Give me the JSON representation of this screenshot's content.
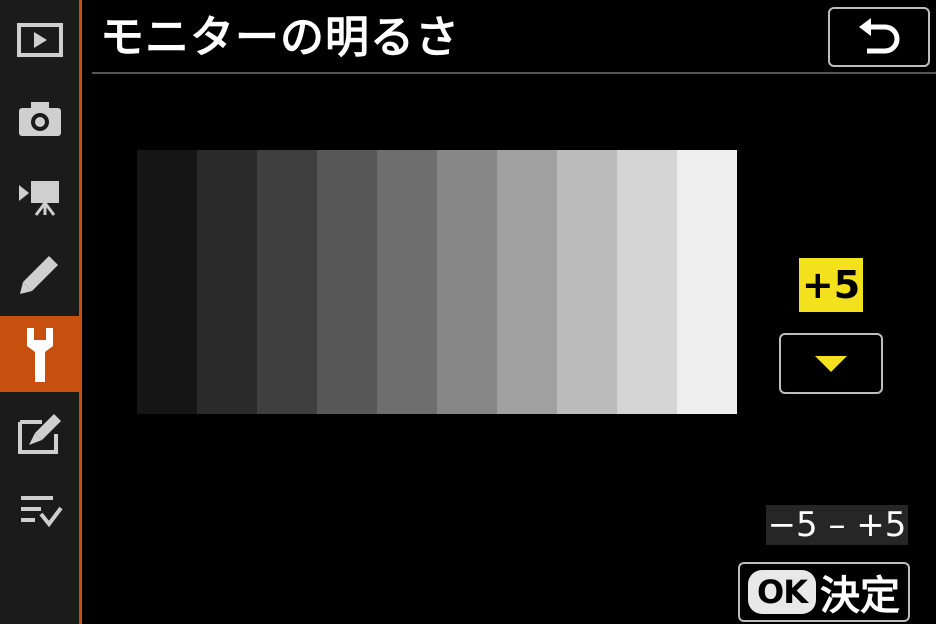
{
  "title": "モニターの明るさ",
  "sidebar": {
    "items": [
      {
        "icon": "playback-icon",
        "active": false
      },
      {
        "icon": "camera-icon",
        "active": false
      },
      {
        "icon": "movie-camera-icon",
        "active": false
      },
      {
        "icon": "pencil-icon",
        "active": false
      },
      {
        "icon": "wrench-icon",
        "active": true
      },
      {
        "icon": "retouch-icon",
        "active": false
      },
      {
        "icon": "my-menu-icon",
        "active": false
      }
    ],
    "active_color": "#c8500f"
  },
  "back_icon": "return-arrow-icon",
  "gray_scale": {
    "swatch_colors": [
      "#151515",
      "#2a2a2b",
      "#3f3f40",
      "#575758",
      "#6e6e6f",
      "#868687",
      "#a0a0a1",
      "#bbbbbc",
      "#d5d5d6",
      "#eeeeef"
    ]
  },
  "brightness": {
    "value": "+5",
    "badge_color": "#f2e11c",
    "range": "−5 – +5",
    "down_icon": "triangle-down-icon"
  },
  "ok": {
    "icon_text": "OK",
    "label": "決定"
  }
}
